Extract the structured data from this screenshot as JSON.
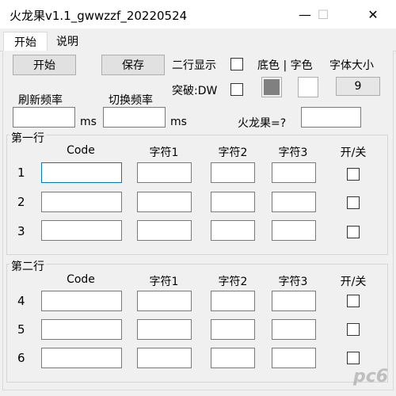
{
  "window": {
    "title": "火龙果v1.1_gwwzzf_20220524",
    "minimize": "—",
    "maximize": "☐",
    "close": "✕"
  },
  "tabs": [
    {
      "label": "开始",
      "selected": true
    },
    {
      "label": "说明",
      "selected": false
    }
  ],
  "toolbar": {
    "start_label": "开始",
    "save_label": "保存",
    "two_line_label": "二行显示",
    "breakthrough_label": "突破:DW",
    "bg_color_label": "底色 | 字色",
    "font_size_label": "字体大小",
    "font_size_value": "9",
    "bg_color": "#808080",
    "text_color": "#ffffff",
    "refresh_label": "刷新频率",
    "switch_label": "切换频率",
    "unit_ms": "ms",
    "question_label": "火龙果=?"
  },
  "group1": {
    "title": "第一行",
    "headers": [
      "Code",
      "字符1",
      "字符2",
      "字符3",
      "开/关"
    ],
    "rows": [
      "1",
      "2",
      "3"
    ]
  },
  "group2": {
    "title": "第二行",
    "headers": [
      "Code",
      "字符1",
      "字符2",
      "字符3",
      "开/关"
    ],
    "rows": [
      "4",
      "5",
      "6"
    ]
  },
  "watermark": "pc6"
}
